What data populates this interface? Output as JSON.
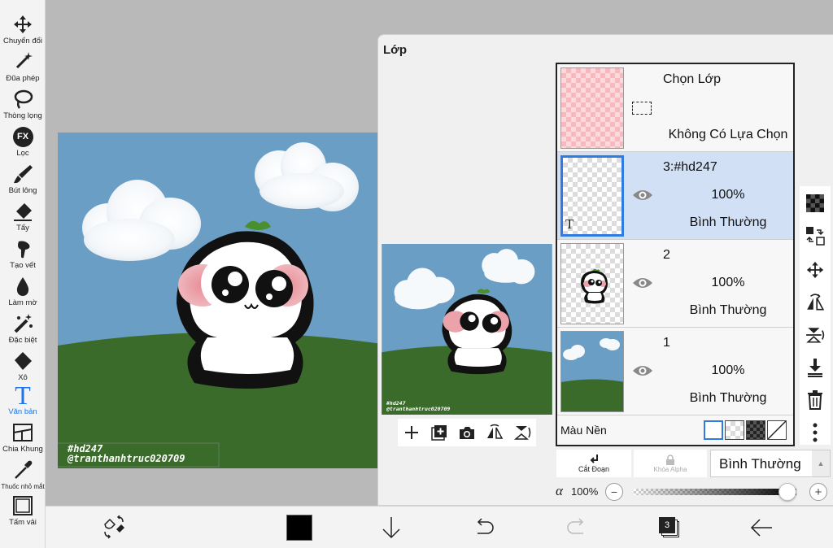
{
  "toolbar": {
    "tools": [
      {
        "label": "Chuyển đổi",
        "icon": "move-icon"
      },
      {
        "label": "Đũa phép",
        "icon": "magic-wand-icon"
      },
      {
        "label": "Thòng lọng",
        "icon": "lasso-icon"
      },
      {
        "label": "Lọc",
        "icon": "fx-filter-icon",
        "badge": "FX"
      },
      {
        "label": "Bút lông",
        "icon": "brush-icon"
      },
      {
        "label": "Tẩy",
        "icon": "eraser-icon"
      },
      {
        "label": "Tạo vết",
        "icon": "smudge-icon"
      },
      {
        "label": "Làm mờ",
        "icon": "blur-icon"
      },
      {
        "label": "Đặc biệt",
        "icon": "special-brush-icon"
      },
      {
        "label": "Xô",
        "icon": "bucket-icon"
      },
      {
        "label": "Văn bản",
        "icon": "text-icon",
        "glyph": "T",
        "active": true
      },
      {
        "label": "Chia Khung",
        "icon": "frame-divider-icon"
      },
      {
        "label": "Thuốc nhỏ mắt",
        "icon": "eyedropper-icon"
      },
      {
        "label": "Tấm vải",
        "icon": "canvas-icon"
      }
    ],
    "active_color": "#1e73e8"
  },
  "canvas": {
    "watermark_line1": "#hd247",
    "watermark_line2": "@tranthanhtruc020709"
  },
  "layer_panel": {
    "title": "Lớp",
    "selection_layer": {
      "name": "Chọn Lớp",
      "status": "Không Có Lựa Chọn"
    },
    "layers": [
      {
        "name": "3:#hd247",
        "opacity": "100%",
        "blend": "Bình Thường",
        "selected": true,
        "type_badge": "T"
      },
      {
        "name": "2",
        "opacity": "100%",
        "blend": "Bình Thường",
        "selected": false
      },
      {
        "name": "1",
        "opacity": "100%",
        "blend": "Bình Thường",
        "selected": false
      }
    ],
    "background_label": "Màu Nền",
    "clip_label": "Cắt Đoạn",
    "alpha_lock_label": "Khóa Alpha",
    "blend_mode": "Bình Thường",
    "alpha_symbol": "α",
    "opacity_value": "100%",
    "opacity_fraction": 1.0,
    "minus_label": "−",
    "plus_label": "+"
  },
  "bottombar": {
    "layers_count": "3",
    "primary_color": "#000000"
  },
  "colors": {
    "sky": "#6a9ec4",
    "grass": "#3a6b2a",
    "selected_row": "#d2e0f6",
    "selected_border": "#2f7be0"
  }
}
